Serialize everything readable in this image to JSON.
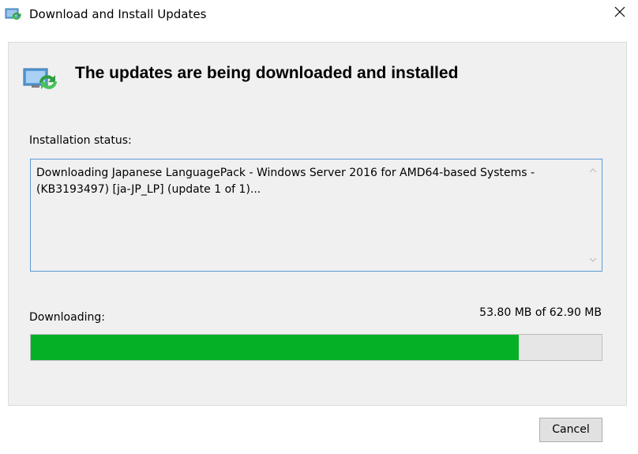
{
  "window": {
    "title": "Download and Install Updates",
    "title_icon": "windows-update-icon",
    "close_icon": "close-icon"
  },
  "header": {
    "icon": "windows-update-icon",
    "text": "The updates are being downloaded and installed"
  },
  "status": {
    "label": "Installation status:",
    "text": "Downloading Japanese LanguagePack - Windows Server 2016 for AMD64-based Systems - (KB3193497) [ja-JP_LP] (update 1 of 1)..."
  },
  "download": {
    "label": "Downloading:",
    "size_text": "53.80 MB of 62.90 MB",
    "progress_fraction": 0.855
  },
  "buttons": {
    "cancel_label": "Cancel"
  },
  "colors": {
    "progress_fill": "#06b025",
    "status_border": "#5b9bd5"
  }
}
